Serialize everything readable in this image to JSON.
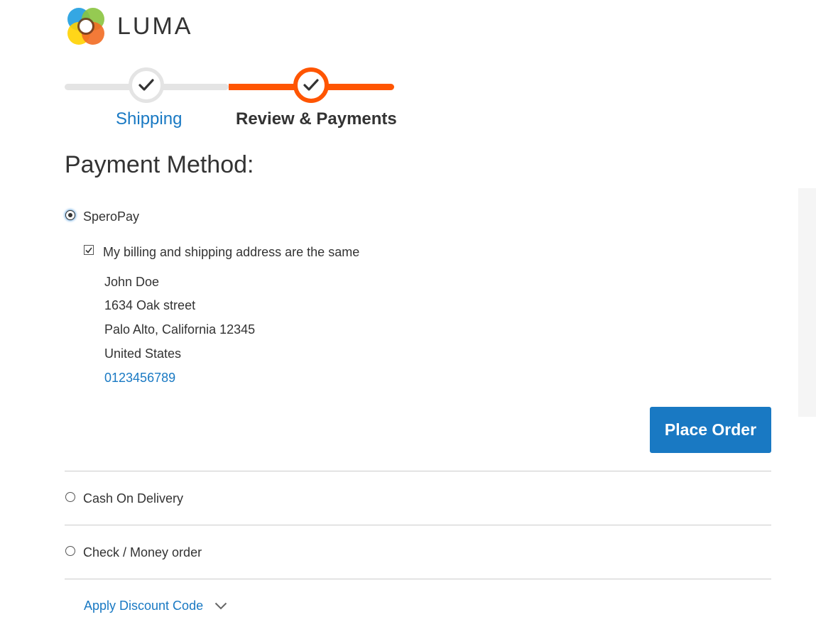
{
  "brand": {
    "name": "LUMA",
    "logo_icon": "luma-logo-icon"
  },
  "progress": {
    "steps": [
      {
        "label": "Shipping",
        "state": "complete"
      },
      {
        "label": "Review & Payments",
        "state": "active"
      }
    ],
    "colors": {
      "active": "#ff5501",
      "inactive": "#e4e4e4"
    }
  },
  "payment": {
    "title": "Payment Method:",
    "methods": [
      {
        "label": "SperoPay",
        "selected": true
      },
      {
        "label": "Cash On Delivery",
        "selected": false
      },
      {
        "label": "Check / Money order",
        "selected": false
      }
    ],
    "same_address_label": "My billing and shipping address are the same",
    "same_address_checked": true,
    "address": {
      "name": "John Doe",
      "street": "1634 Oak street",
      "city_region": "Palo Alto, California 12345",
      "country": "United States",
      "phone": "0123456789"
    },
    "place_order_label": "Place Order"
  },
  "discount": {
    "label": "Apply Discount Code",
    "icon": "chevron-down-icon"
  },
  "colors": {
    "link": "#1979c3",
    "primary_button": "#1979c3",
    "text": "#333333"
  }
}
